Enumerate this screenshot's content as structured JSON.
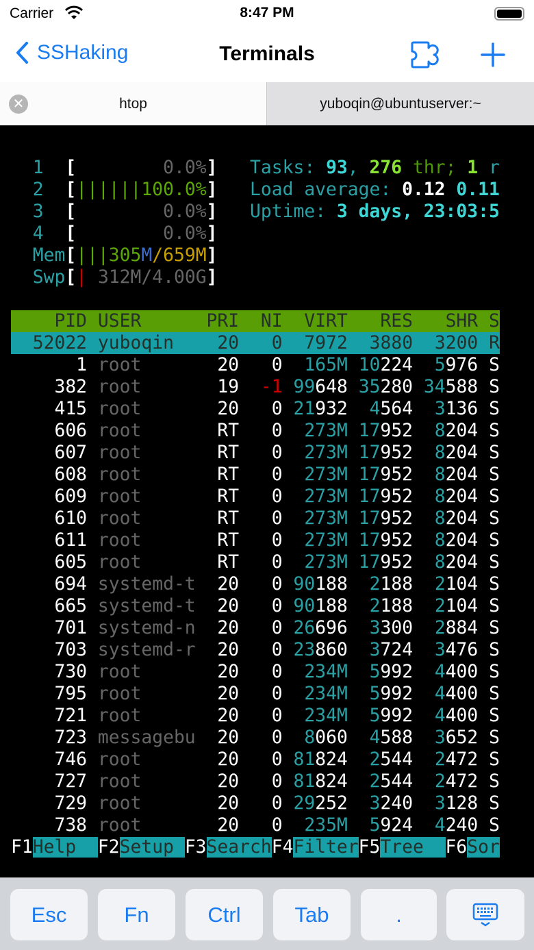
{
  "status": {
    "carrier": "Carrier",
    "time": "8:47 PM"
  },
  "nav": {
    "back_label": "SSHaking",
    "title": "Terminals"
  },
  "tabs": [
    {
      "label": "htop",
      "active": true
    },
    {
      "label": "yuboqin@ubuntuserver:~",
      "active": false
    }
  ],
  "meters": {
    "cpus": [
      {
        "id": "1",
        "bar": "",
        "value": "0.0%"
      },
      {
        "id": "2",
        "bar": "||||||",
        "value": "100.0%"
      },
      {
        "id": "3",
        "bar": "",
        "value": "0.0%"
      },
      {
        "id": "4",
        "bar": "",
        "value": "0.0%"
      }
    ],
    "mem": {
      "label": "Mem",
      "bar": "|||",
      "used": "305",
      "unit": "M",
      "total": "/659M"
    },
    "swp": {
      "label": "Swp",
      "bar": "|",
      "value": "312M/4.00G"
    },
    "tasks": {
      "label": "Tasks: ",
      "count": "93",
      "sep": ", ",
      "threads": "276",
      "thr": " thr; ",
      "running": "1",
      "r": " r"
    },
    "load": {
      "label": "Load average: ",
      "l1": "0.12",
      "l5": "0.11"
    },
    "uptime": {
      "label": "Uptime: ",
      "value": "3 days, 23:03:5"
    }
  },
  "columns": [
    "PID",
    "USER",
    "PRI",
    "NI",
    "VIRT",
    "RES",
    "SHR",
    "S"
  ],
  "processes": [
    {
      "pid": "52022",
      "user": "yuboqin",
      "pri": "20",
      "ni": "0",
      "virt": "7972",
      "res": "3880",
      "shr": "3200",
      "s": "R",
      "selected": true
    },
    {
      "pid": "1",
      "user": "root",
      "pri": "20",
      "ni": "0",
      "virt": "165M",
      "res": "10224",
      "shr": "5976",
      "s": "S"
    },
    {
      "pid": "382",
      "user": "root",
      "pri": "19",
      "ni": "-1",
      "virt": "99648",
      "res": "35280",
      "shr": "34588",
      "s": "S"
    },
    {
      "pid": "415",
      "user": "root",
      "pri": "20",
      "ni": "0",
      "virt": "21932",
      "res": "4564",
      "shr": "3136",
      "s": "S"
    },
    {
      "pid": "606",
      "user": "root",
      "pri": "RT",
      "ni": "0",
      "virt": "273M",
      "res": "17952",
      "shr": "8204",
      "s": "S"
    },
    {
      "pid": "607",
      "user": "root",
      "pri": "RT",
      "ni": "0",
      "virt": "273M",
      "res": "17952",
      "shr": "8204",
      "s": "S"
    },
    {
      "pid": "608",
      "user": "root",
      "pri": "RT",
      "ni": "0",
      "virt": "273M",
      "res": "17952",
      "shr": "8204",
      "s": "S"
    },
    {
      "pid": "609",
      "user": "root",
      "pri": "RT",
      "ni": "0",
      "virt": "273M",
      "res": "17952",
      "shr": "8204",
      "s": "S"
    },
    {
      "pid": "610",
      "user": "root",
      "pri": "RT",
      "ni": "0",
      "virt": "273M",
      "res": "17952",
      "shr": "8204",
      "s": "S"
    },
    {
      "pid": "611",
      "user": "root",
      "pri": "RT",
      "ni": "0",
      "virt": "273M",
      "res": "17952",
      "shr": "8204",
      "s": "S"
    },
    {
      "pid": "605",
      "user": "root",
      "pri": "RT",
      "ni": "0",
      "virt": "273M",
      "res": "17952",
      "shr": "8204",
      "s": "S"
    },
    {
      "pid": "694",
      "user": "systemd-t",
      "pri": "20",
      "ni": "0",
      "virt": "90188",
      "res": "2188",
      "shr": "2104",
      "s": "S"
    },
    {
      "pid": "665",
      "user": "systemd-t",
      "pri": "20",
      "ni": "0",
      "virt": "90188",
      "res": "2188",
      "shr": "2104",
      "s": "S"
    },
    {
      "pid": "701",
      "user": "systemd-n",
      "pri": "20",
      "ni": "0",
      "virt": "26696",
      "res": "3300",
      "shr": "2884",
      "s": "S"
    },
    {
      "pid": "703",
      "user": "systemd-r",
      "pri": "20",
      "ni": "0",
      "virt": "23860",
      "res": "3724",
      "shr": "3476",
      "s": "S"
    },
    {
      "pid": "730",
      "user": "root",
      "pri": "20",
      "ni": "0",
      "virt": "234M",
      "res": "5992",
      "shr": "4400",
      "s": "S"
    },
    {
      "pid": "795",
      "user": "root",
      "pri": "20",
      "ni": "0",
      "virt": "234M",
      "res": "5992",
      "shr": "4400",
      "s": "S"
    },
    {
      "pid": "721",
      "user": "root",
      "pri": "20",
      "ni": "0",
      "virt": "234M",
      "res": "5992",
      "shr": "4400",
      "s": "S"
    },
    {
      "pid": "723",
      "user": "messagebu",
      "pri": "20",
      "ni": "0",
      "virt": "8060",
      "res": "4588",
      "shr": "3652",
      "s": "S"
    },
    {
      "pid": "746",
      "user": "root",
      "pri": "20",
      "ni": "0",
      "virt": "81824",
      "res": "2544",
      "shr": "2472",
      "s": "S"
    },
    {
      "pid": "727",
      "user": "root",
      "pri": "20",
      "ni": "0",
      "virt": "81824",
      "res": "2544",
      "shr": "2472",
      "s": "S"
    },
    {
      "pid": "729",
      "user": "root",
      "pri": "20",
      "ni": "0",
      "virt": "29252",
      "res": "3240",
      "shr": "3128",
      "s": "S"
    },
    {
      "pid": "738",
      "user": "root",
      "pri": "20",
      "ni": "0",
      "virt": "235M",
      "res": "5924",
      "shr": "4240",
      "s": "S"
    }
  ],
  "fkeys": [
    {
      "key": "F1",
      "label": "Help  "
    },
    {
      "key": "F2",
      "label": "Setup "
    },
    {
      "key": "F3",
      "label": "Search"
    },
    {
      "key": "F4",
      "label": "Filter"
    },
    {
      "key": "F5",
      "label": "Tree  "
    },
    {
      "key": "F6",
      "label": "Sor"
    }
  ],
  "toolbar": {
    "esc": "Esc",
    "fn": "Fn",
    "ctrl": "Ctrl",
    "tab": "Tab",
    "dot": "."
  },
  "icons": {
    "back": "chevron-left-icon",
    "extensions": "puzzle-icon",
    "add": "plus-icon",
    "keyboard": "keyboard-hide-icon"
  }
}
